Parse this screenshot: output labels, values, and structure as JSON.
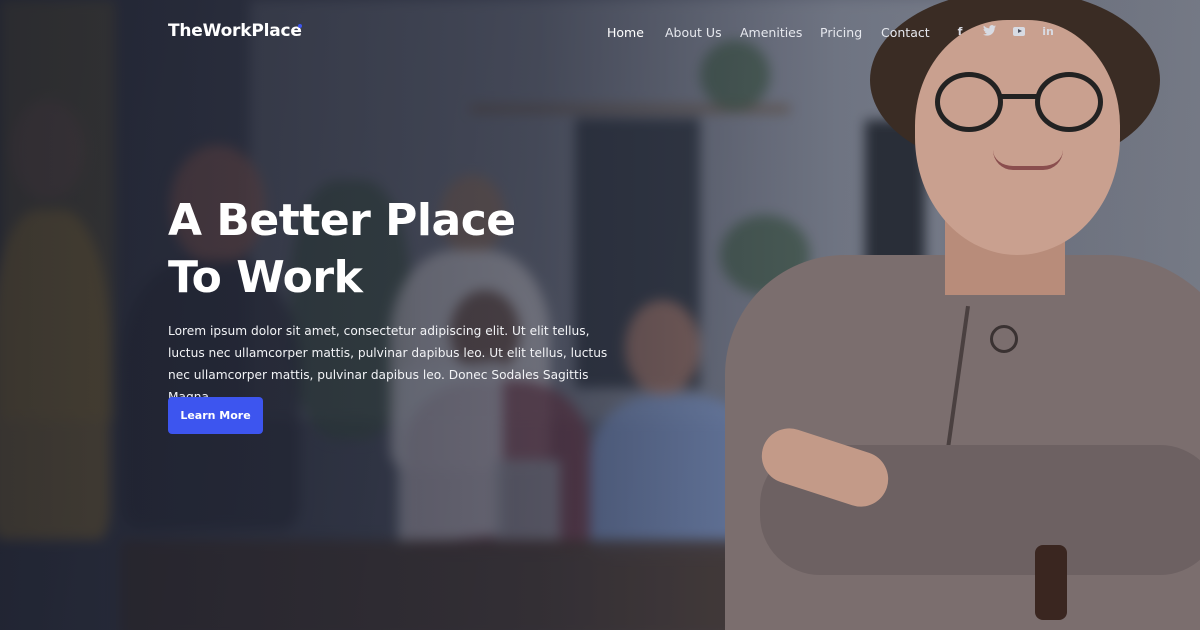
{
  "brand": {
    "name": "TheWorkPlace",
    "accent_color": "#3d55ef"
  },
  "nav": {
    "items": [
      {
        "label": "Home",
        "active": true
      },
      {
        "label": "About Us",
        "active": false
      },
      {
        "label": "Amenities",
        "active": false
      },
      {
        "label": "Pricing",
        "active": false
      },
      {
        "label": "Contact",
        "active": false
      }
    ]
  },
  "social": [
    {
      "icon": "facebook-icon",
      "glyph": "f"
    },
    {
      "icon": "twitter-icon",
      "glyph": "🐦"
    },
    {
      "icon": "youtube-icon",
      "glyph": ""
    },
    {
      "icon": "linkedin-icon",
      "glyph": "in"
    }
  ],
  "hero": {
    "title_line1": "A Better Place",
    "title_line2": "To Work",
    "description": "Lorem ipsum dolor sit amet, consectetur adipiscing elit. Ut elit tellus, luctus nec ullamcorper mattis, pulvinar dapibus leo. Ut elit tellus, luctus nec ullamcorper mattis, pulvinar dapibus leo. Donec Sodales Sagittis Magna.",
    "cta_label": "Learn More",
    "cta_color": "#3d55ef"
  }
}
